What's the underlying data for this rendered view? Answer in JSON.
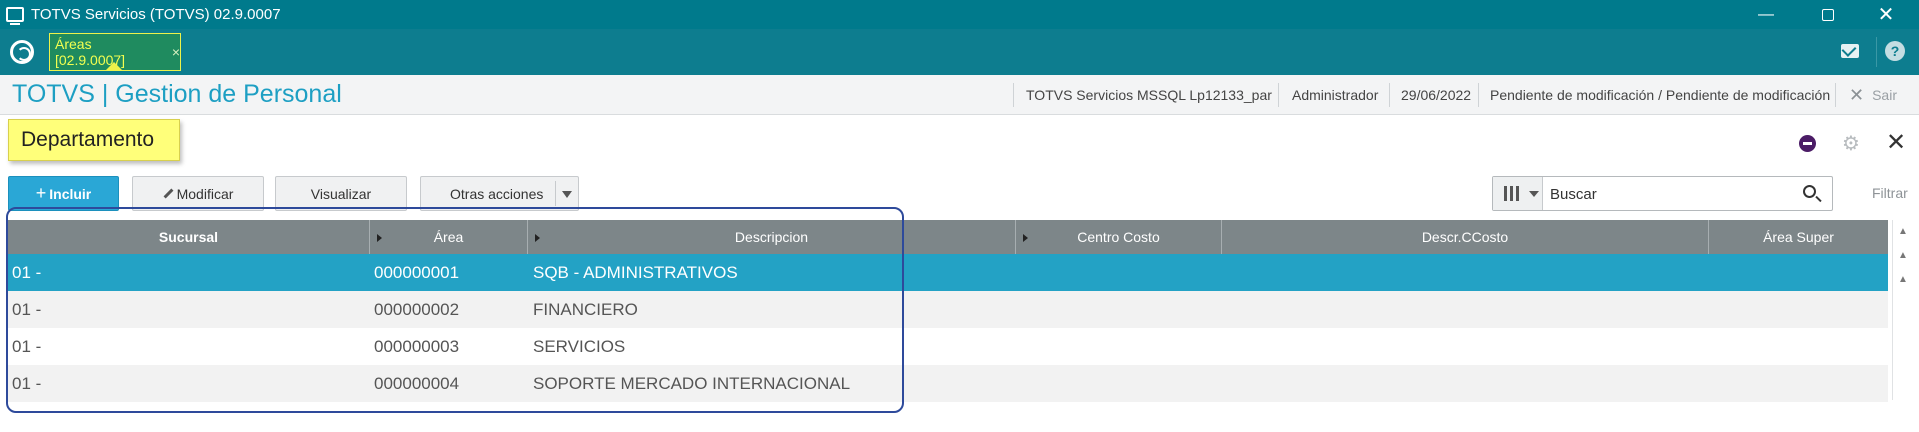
{
  "window": {
    "title": "TOTVS Servicios (TOTVS) 02.9.0007",
    "minimize_icon": "minimize-icon",
    "restore_icon": "restore-icon",
    "close_icon": "close-icon"
  },
  "tabbar": {
    "tab_label": "Áreas [02.9.0007]",
    "tab_close": "×"
  },
  "header": {
    "app_title": "TOTVS | Gestion de Personal",
    "environment": "TOTVS Servicios MSSQL Lp12133_par",
    "user": "Administrador",
    "date": "29/06/2022",
    "status": "Pendiente de modificación / Pendiente de modificación",
    "exit_label": "Sair"
  },
  "routine": {
    "title": "Departamento"
  },
  "toolbar": {
    "include_label": "Incluir",
    "modify_label": "Modificar",
    "view_label": "Visualizar",
    "other_actions_label": "Otras acciones",
    "search_placeholder": "Buscar",
    "filter_label": "Filtrar"
  },
  "grid": {
    "columns": [
      "Sucursal",
      "Área",
      "Descripcion",
      "Centro Costo",
      "Descr.CCosto",
      "Área Super"
    ],
    "rows": [
      {
        "sucursal": "01  -",
        "area": "000000001",
        "descripcion": "SQB - ADMINISTRATIVOS",
        "selected": true
      },
      {
        "sucursal": "01  -",
        "area": "000000002",
        "descripcion": "FINANCIERO",
        "selected": false
      },
      {
        "sucursal": "01  -",
        "area": "000000003",
        "descripcion": "SERVICIOS",
        "selected": false
      },
      {
        "sucursal": "01  -",
        "area": "000000004",
        "descripcion": "SOPORTE MERCADO INTERNACIONAL",
        "selected": false
      }
    ]
  },
  "colors": {
    "titlebar": "#007a8c",
    "accent": "#1d9fc3",
    "selected_row": "#23a2c5",
    "highlight_border": "#2e4a9b",
    "routine_label": "#ffff7a"
  }
}
